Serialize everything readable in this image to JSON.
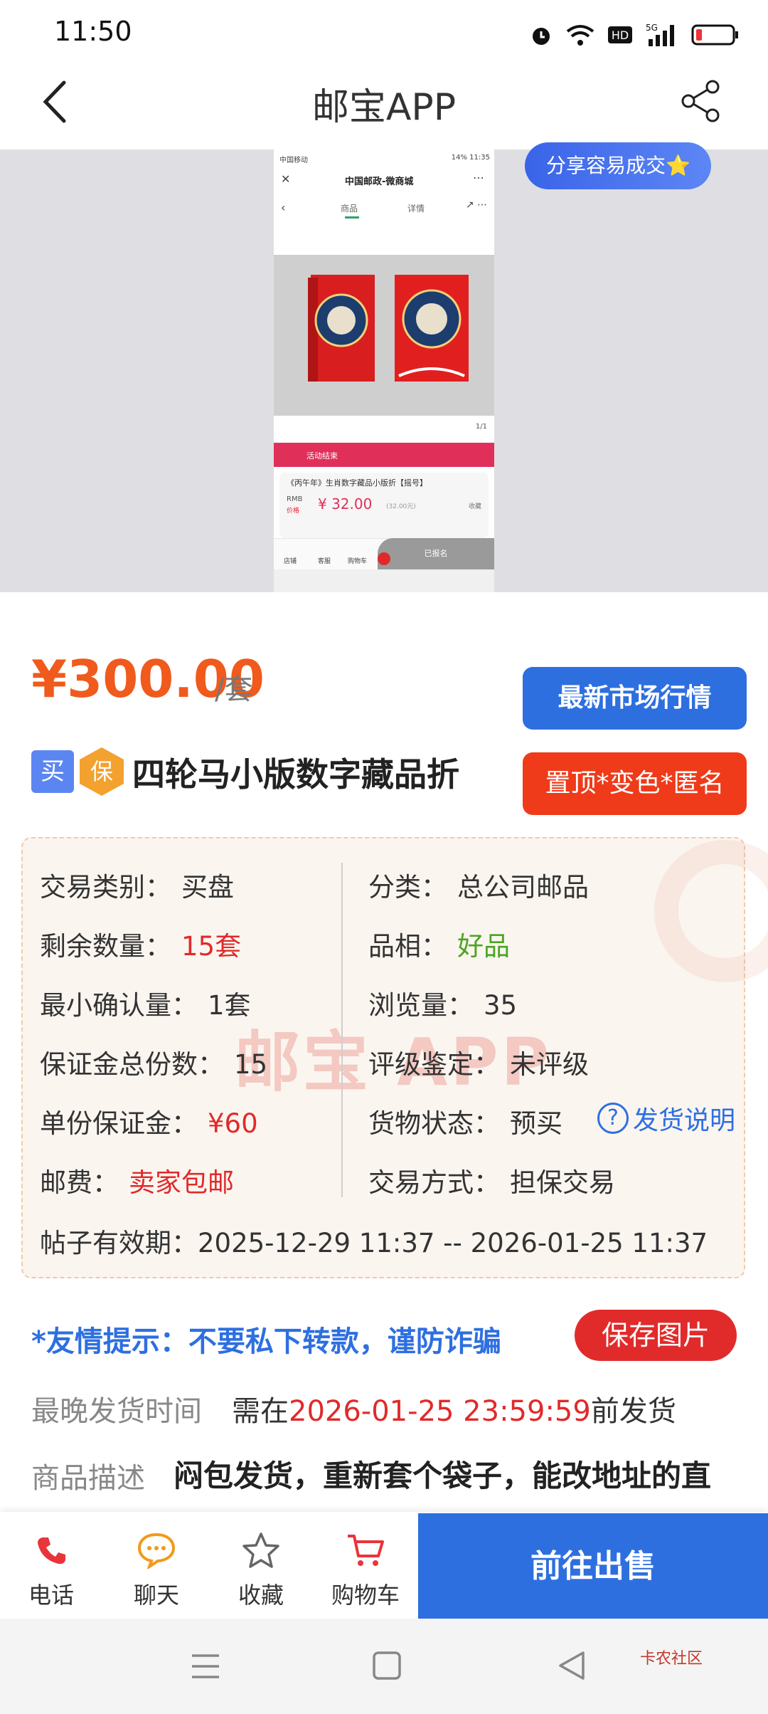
{
  "status_bar": {
    "time": "11:50"
  },
  "header": {
    "title": "邮宝APP"
  },
  "preview": {
    "share_badge": "分享容易成交⭐",
    "screenshot": {
      "status_left": "中国移动",
      "status_right": "14% 11:35",
      "mall_title": "中国邮政-微商城",
      "tab_goods": "商品",
      "tab_detail": "详情",
      "page_counter": "1/1",
      "activity_text": "活动结束",
      "product_title": "《丙午年》生肖数字藏品小版折【摇号】",
      "currency": "RMB",
      "price_label": "价格",
      "price": "¥ 32.00",
      "price_small": "(32.00元)",
      "favorite": "收藏",
      "shop": "店铺",
      "service": "客服",
      "cart": "购物车",
      "enrolled": "已报名"
    }
  },
  "price": {
    "amount": "¥300.00",
    "unit": "/套"
  },
  "buttons": {
    "market": "最新市场行情",
    "promote": "置顶*变色*匿名",
    "save_image": "保存图片",
    "sell": "前往出售"
  },
  "item": {
    "tag_buy": "买",
    "tag_guarantee": "保",
    "title": "四轮马小版数字藏品折"
  },
  "info": {
    "watermark": "邮宝 APP",
    "left": [
      {
        "label": "交易类别：",
        "value": "买盘"
      },
      {
        "label": "剩余数量：",
        "value": "15套"
      },
      {
        "label": "最小确认量：",
        "value": "1套"
      },
      {
        "label": "保证金总份数：",
        "value": "15"
      },
      {
        "label": "单份保证金：",
        "value": "¥60"
      },
      {
        "label": "邮费：",
        "value": "卖家包邮"
      }
    ],
    "right": [
      {
        "label": "分类：",
        "value": "总公司邮品"
      },
      {
        "label": "品相：",
        "value": "好品"
      },
      {
        "label": "浏览量：",
        "value": "35"
      },
      {
        "label": "评级鉴定：",
        "value": "未评级"
      },
      {
        "label": "货物状态：",
        "value": "预买"
      },
      {
        "label": "交易方式：",
        "value": "担保交易"
      }
    ],
    "help_link": "发货说明",
    "validity_label": "帖子有效期：",
    "validity_value": "2025-12-29 11:37 -- 2026-01-25 11:37"
  },
  "notice": "*友情提示：不要私下转款，谨防诈骗",
  "shipping": {
    "label": "最晚发货时间",
    "prefix": "需在",
    "deadline": "2026-01-25 23:59:59",
    "suffix": "前发货"
  },
  "description": {
    "label": "商品描述",
    "text": "闷包发货，重新套个袋子，能改地址的直"
  },
  "actions": [
    {
      "label": "电话",
      "icon": "phone-icon"
    },
    {
      "label": "聊天",
      "icon": "chat-icon"
    },
    {
      "label": "收藏",
      "icon": "star-icon"
    },
    {
      "label": "购物车",
      "icon": "cart-icon"
    }
  ],
  "footer_logo": "卡农社区",
  "colors": {
    "accent_blue": "#2e6fe0",
    "price_orange": "#f05a1c",
    "alert_red": "#e02a2a",
    "good_green": "#49a521"
  }
}
